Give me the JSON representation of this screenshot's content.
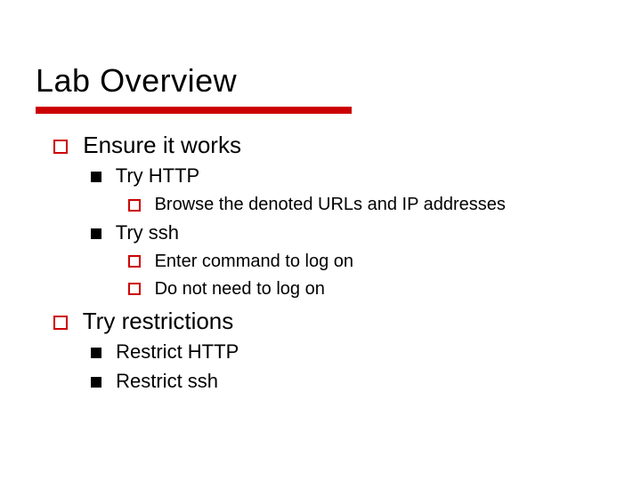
{
  "title": "Lab Overview",
  "outline": [
    {
      "text": "Ensure it works",
      "children": [
        {
          "text": "Try HTTP",
          "children": [
            {
              "text": "Browse the denoted URLs and IP addresses"
            }
          ]
        },
        {
          "text": "Try ssh",
          "children": [
            {
              "text": "Enter command to log on"
            },
            {
              "text": "Do not need to log on"
            }
          ]
        }
      ]
    },
    {
      "text": "Try restrictions",
      "children": [
        {
          "text": "Restrict HTTP"
        },
        {
          "text": "Restrict ssh"
        }
      ]
    }
  ]
}
